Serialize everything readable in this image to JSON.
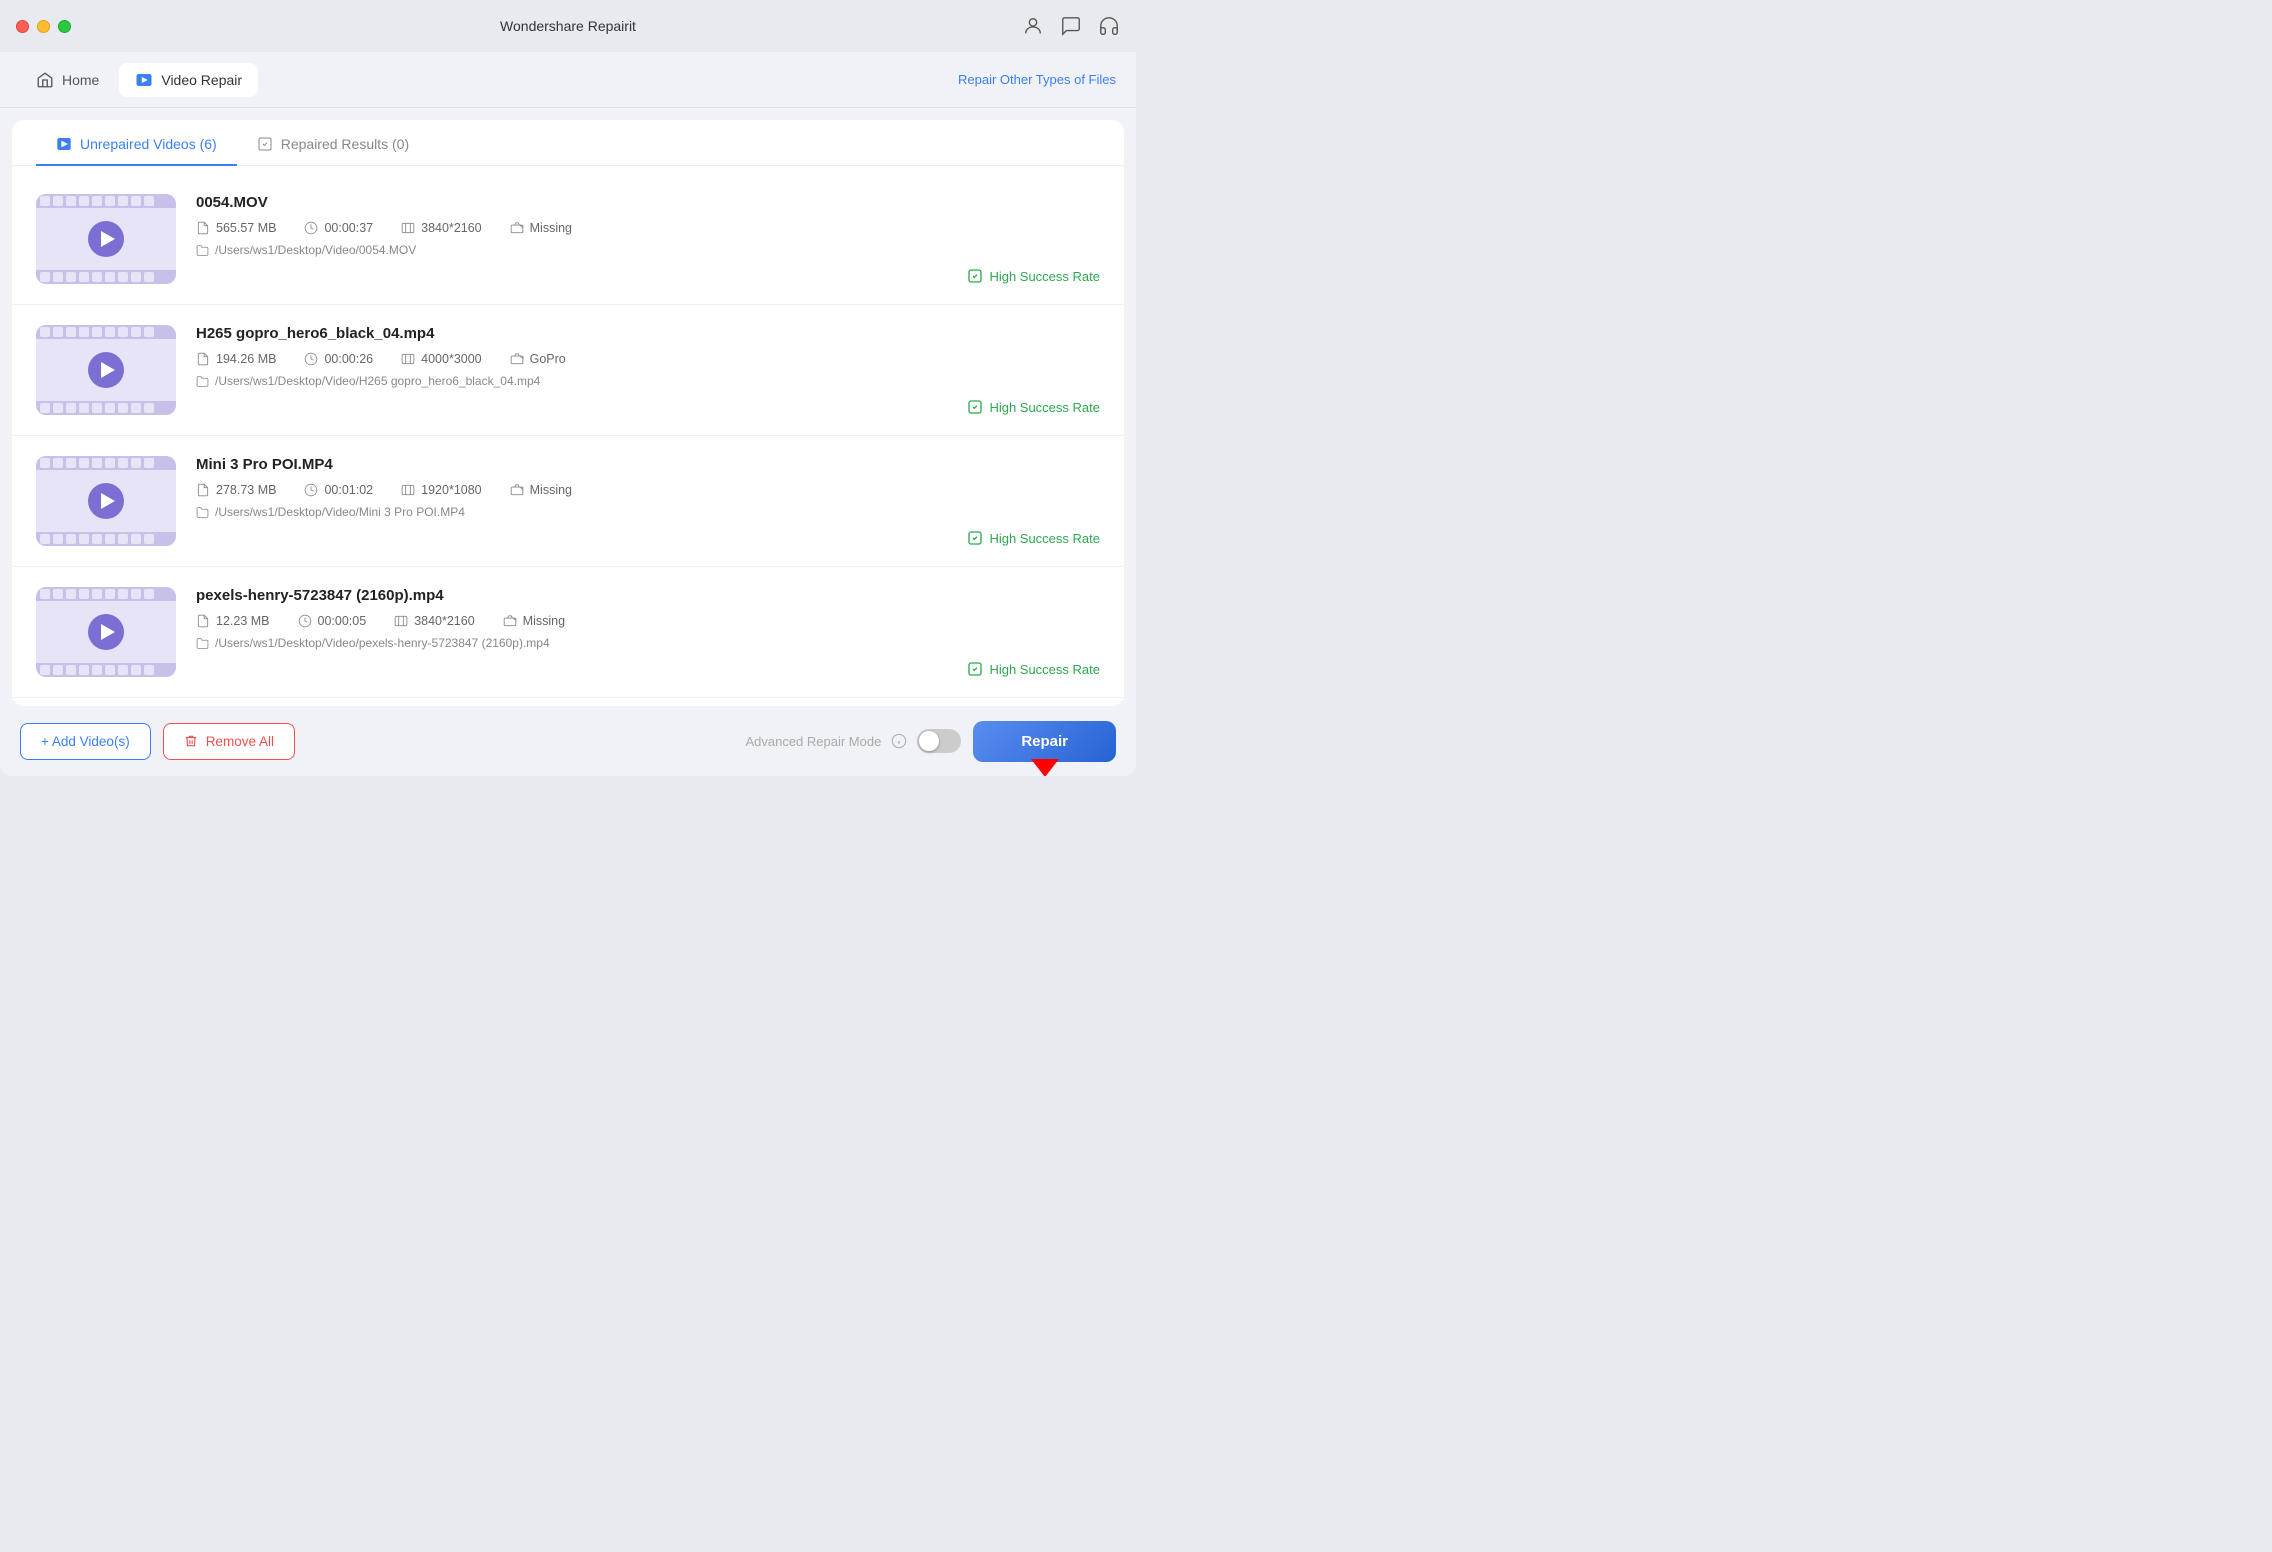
{
  "app": {
    "title": "Wondershare Repairit"
  },
  "nav": {
    "home_label": "Home",
    "video_repair_label": "Video Repair",
    "repair_other_link": "Repair Other Types of Files"
  },
  "tabs": {
    "unrepaired_label": "Unrepaired Videos (6)",
    "repaired_label": "Repaired Results (0)"
  },
  "videos": [
    {
      "name": "0054.MOV",
      "size": "565.57 MB",
      "duration": "00:00:37",
      "resolution": "3840*2160",
      "camera": "Missing",
      "path": "/Users/ws1/Desktop/Video/0054.MOV",
      "success": "High Success Rate"
    },
    {
      "name": "H265 gopro_hero6_black_04.mp4",
      "size": "194.26 MB",
      "duration": "00:00:26",
      "resolution": "4000*3000",
      "camera": "GoPro",
      "path": "/Users/ws1/Desktop/Video/H265 gopro_hero6_black_04.mp4",
      "success": "High Success Rate"
    },
    {
      "name": "Mini 3 Pro POI.MP4",
      "size": "278.73 MB",
      "duration": "00:01:02",
      "resolution": "1920*1080",
      "camera": "Missing",
      "path": "/Users/ws1/Desktop/Video/Mini 3 Pro POI.MP4",
      "success": "High Success Rate"
    },
    {
      "name": "pexels-henry-5723847 (2160p).mp4",
      "size": "12.23 MB",
      "duration": "00:00:05",
      "resolution": "3840*2160",
      "camera": "Missing",
      "path": "/Users/ws1/Desktop/Video/pexels-henry-5723847 (2160p).mp4",
      "success": "High Success Rate"
    }
  ],
  "bottom": {
    "add_btn": "+ Add Video(s)",
    "remove_btn": "Remove All",
    "advanced_mode_label": "Advanced Repair Mode",
    "repair_btn": "Repair"
  }
}
